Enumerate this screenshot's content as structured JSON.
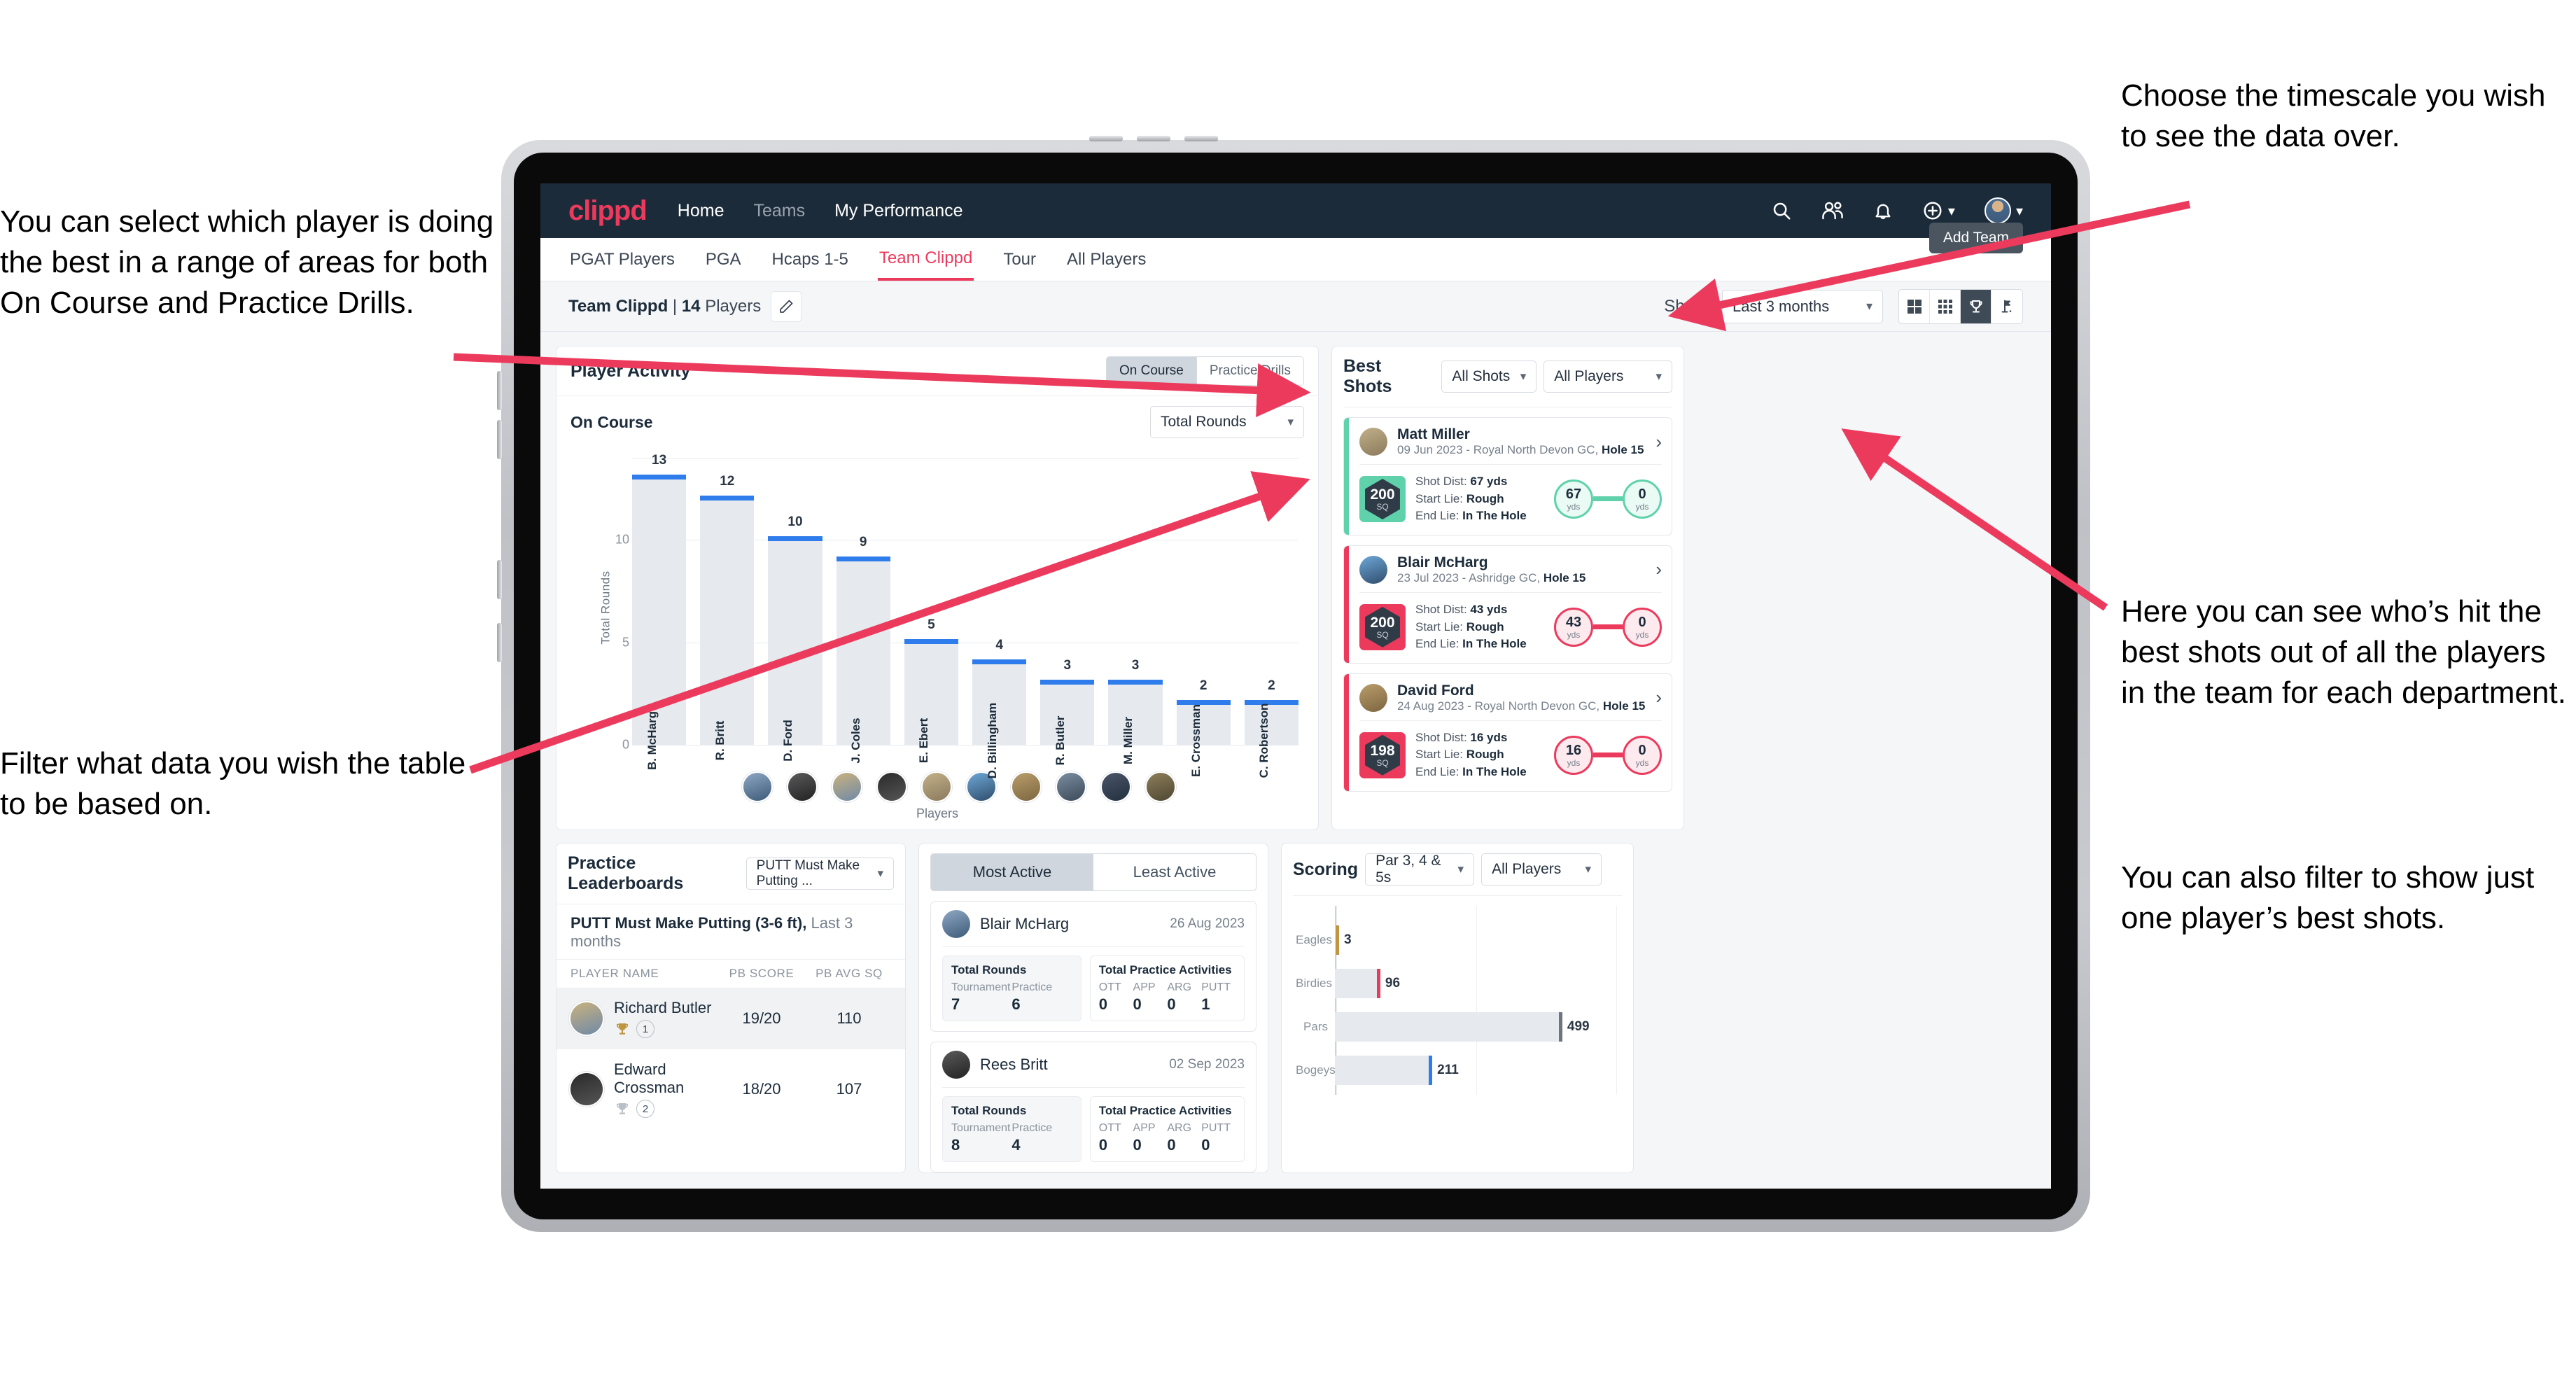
{
  "annotations": {
    "left_top": "You can select which player is doing the best in a range of areas for both On Course and Practice Drills.",
    "left_bottom": "Filter what data you wish the table to be based on.",
    "right_top": "Choose the timescale you wish to see the data over.",
    "right_middle": "Here you can see who’s hit the best shots out of all the players in the team for each department.",
    "right_bottom": "You can also filter to show just one player’s best shots."
  },
  "navbar": {
    "logo": "clippd",
    "links": [
      {
        "label": "Home",
        "dim": false
      },
      {
        "label": "Teams",
        "dim": true
      },
      {
        "label": "My Performance",
        "dim": false
      }
    ],
    "icons": [
      "search-icon",
      "people-icon",
      "bell-icon",
      "plus-circle-icon",
      "avatar"
    ]
  },
  "tabs": {
    "items": [
      {
        "label": "PGAT Players",
        "state": "normal"
      },
      {
        "label": "PGA",
        "state": "normal"
      },
      {
        "label": "Hcaps 1-5",
        "state": "normal"
      },
      {
        "label": "Team Clippd",
        "state": "active"
      },
      {
        "label": "Tour",
        "state": "normal"
      },
      {
        "label": "All Players",
        "state": "normal"
      }
    ],
    "tooltip": "Add Team"
  },
  "subheader": {
    "team_name": "Team Clippd",
    "separator": "|",
    "player_count": "14",
    "players_word": "Players",
    "edit_icon": "pencil-icon",
    "show_label": "Show:",
    "timescale_value": "Last 3 months",
    "view_toggles": [
      "grid-large-icon",
      "grid-small-icon",
      "trophy-icon",
      "flag-icon"
    ],
    "view_selected_index": 2
  },
  "player_activity": {
    "title": "Player Activity",
    "segments": [
      {
        "label": "On Course",
        "selected": true
      },
      {
        "label": "Practice Drills",
        "selected": false
      }
    ],
    "section_label": "On Course",
    "metric_select": "Total Rounds"
  },
  "chart_data": {
    "type": "bar",
    "title": "Player Activity — On Course",
    "xlabel": "Players",
    "ylabel": "Total Rounds",
    "ylim": [
      0,
      14
    ],
    "yticks": [
      0,
      5,
      10
    ],
    "grid": true,
    "categories": [
      "B. McHarg",
      "R. Britt",
      "D. Ford",
      "J. Coles",
      "E. Ebert",
      "D. Billingham",
      "R. Butler",
      "M. Miller",
      "E. Crossman",
      "C. Robertson"
    ],
    "values": [
      13,
      12,
      10,
      9,
      5,
      4,
      3,
      3,
      2,
      2
    ]
  },
  "best_shots": {
    "title": "Best Shots",
    "shot_filter": "All Shots",
    "player_filter": "All Players",
    "cards": [
      {
        "name": "Matt Miller",
        "meta_date": "09 Jun 2023",
        "meta_course": "Royal North Devon GC,",
        "meta_hole": "Hole 15",
        "sq": "200",
        "sq_unit": "SQ",
        "accent": "#5fd2ab",
        "shot_dist_label": "Shot Dist:",
        "shot_dist": "67 yds",
        "start_lie_label": "Start Lie:",
        "start_lie": "Rough",
        "end_lie_label": "End Lie:",
        "end_lie": "In The Hole",
        "from_value": "67",
        "from_unit": "yds",
        "to_value": "0",
        "to_unit": "yds"
      },
      {
        "name": "Blair McHarg",
        "meta_date": "23 Jul 2023",
        "meta_course": "Ashridge GC,",
        "meta_hole": "Hole 15",
        "sq": "200",
        "sq_unit": "SQ",
        "accent": "#ec3a5d",
        "shot_dist_label": "Shot Dist:",
        "shot_dist": "43 yds",
        "start_lie_label": "Start Lie:",
        "start_lie": "Rough",
        "end_lie_label": "End Lie:",
        "end_lie": "In The Hole",
        "from_value": "43",
        "from_unit": "yds",
        "to_value": "0",
        "to_unit": "yds"
      },
      {
        "name": "David Ford",
        "meta_date": "24 Aug 2023",
        "meta_course": "Royal North Devon GC,",
        "meta_hole": "Hole 15",
        "sq": "198",
        "sq_unit": "SQ",
        "accent": "#ec3a5d",
        "shot_dist_label": "Shot Dist:",
        "shot_dist": "16 yds",
        "start_lie_label": "Start Lie:",
        "start_lie": "Rough",
        "end_lie_label": "End Lie:",
        "end_lie": "In The Hole",
        "from_value": "16",
        "from_unit": "yds",
        "to_value": "0",
        "to_unit": "yds"
      }
    ]
  },
  "practice_leaderboards": {
    "title": "Practice Leaderboards",
    "drill_select": "PUTT Must Make Putting ...",
    "subtitle_bold": "PUTT Must Make Putting (3-6 ft),",
    "subtitle_rest": "Last 3 months",
    "columns": [
      "PLAYER NAME",
      "PB SCORE",
      "PB AVG SQ"
    ],
    "rows": [
      {
        "name": "Richard Butler",
        "rank": "1",
        "trophy": "gold",
        "pb_score": "19/20",
        "pb_avg_sq": "110"
      },
      {
        "name": "Edward Crossman",
        "rank": "2",
        "trophy": "silver",
        "pb_score": "18/20",
        "pb_avg_sq": "107"
      }
    ]
  },
  "activity": {
    "tabs": [
      {
        "label": "Most Active",
        "selected": true
      },
      {
        "label": "Least Active",
        "selected": false
      }
    ],
    "cards": [
      {
        "name": "Blair McHarg",
        "date": "26 Aug 2023",
        "rounds_title": "Total Rounds",
        "rounds": [
          {
            "key": "Tournament",
            "value": "7"
          },
          {
            "key": "Practice",
            "value": "6"
          }
        ],
        "practice_title": "Total Practice Activities",
        "practice": [
          {
            "key": "OTT",
            "value": "0"
          },
          {
            "key": "APP",
            "value": "0"
          },
          {
            "key": "ARG",
            "value": "0"
          },
          {
            "key": "PUTT",
            "value": "1"
          }
        ]
      },
      {
        "name": "Rees Britt",
        "date": "02 Sep 2023",
        "rounds_title": "Total Rounds",
        "rounds": [
          {
            "key": "Tournament",
            "value": "8"
          },
          {
            "key": "Practice",
            "value": "4"
          }
        ],
        "practice_title": "Total Practice Activities",
        "practice": [
          {
            "key": "OTT",
            "value": "0"
          },
          {
            "key": "APP",
            "value": "0"
          },
          {
            "key": "ARG",
            "value": "0"
          },
          {
            "key": "PUTT",
            "value": "0"
          }
        ]
      }
    ]
  },
  "scoring": {
    "title": "Scoring",
    "par_filter": "Par 3, 4 & 5s",
    "player_filter": "All Players",
    "chart_data": {
      "type": "bar",
      "orientation": "horizontal",
      "title": "Scoring",
      "categories": [
        "Eagles",
        "Birdies",
        "Pars",
        "Bogeys"
      ],
      "values": [
        3,
        96,
        499,
        211
      ],
      "colors": [
        "#bf953f",
        "#ec3a5d",
        "#6c7680",
        "#2f7ded"
      ],
      "xlim": [
        0,
        620
      ],
      "grid": true
    }
  },
  "colors": {
    "brand_pink": "#ec3a5d",
    "navy": "#1c2b3a",
    "bar_blue": "#2f7ded",
    "bar_gray": "#e6e9ed",
    "teal": "#5fd2ab"
  }
}
